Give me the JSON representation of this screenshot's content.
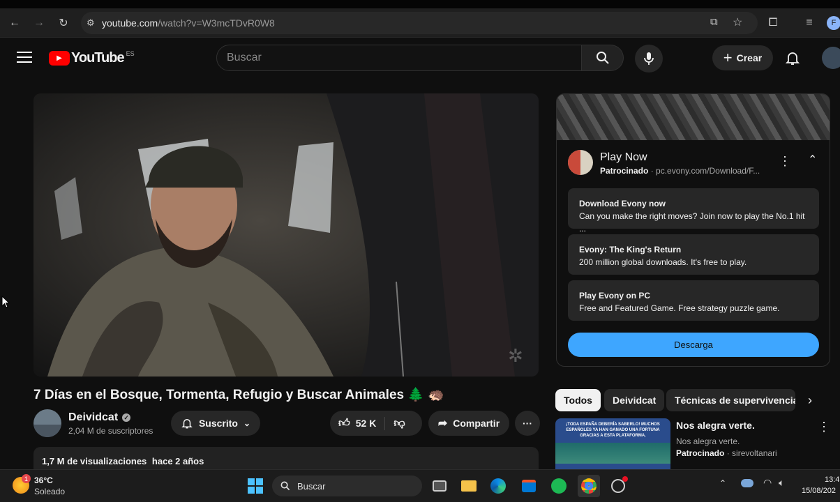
{
  "browser": {
    "url_host": "youtube.com",
    "url_path": "/watch?v=W3mcTDvR0W8",
    "profile_initial": "F"
  },
  "header": {
    "logo_text": "YouTube",
    "region": "ES",
    "search_placeholder": "Buscar",
    "create_label": "Crear"
  },
  "video": {
    "title": "7 Días en el Bosque, Tormenta, Refugio y Buscar Animales 🌲 🦔",
    "channel": "Deividcat",
    "subscribers": "2,04 M de suscriptores",
    "subscribed_label": "Suscrito",
    "likes": "52 K",
    "share_label": "Compartir",
    "views": "1,7 M de visualizaciones",
    "age": "hace 2 años"
  },
  "ad": {
    "title": "Play Now",
    "sponsored": "Patrocinado",
    "domain": "· pc.evony.com/Download/F...",
    "cards": [
      {
        "heading": "Download Evony now",
        "text": "Can you make the right moves? Join now to play the No.1 hit ..."
      },
      {
        "heading": "Evony: The King's Return",
        "text": "200 million global downloads. It's free to play."
      },
      {
        "heading": "Play Evony on PC",
        "text": "Free and Featured Game. Free strategy puzzle game."
      }
    ],
    "cta": "Descarga"
  },
  "chips": [
    "Todos",
    "Deividcat",
    "Técnicas de supervivencia"
  ],
  "rec": {
    "title": "Nos alegra verte.",
    "subtitle": "Nos alegra verte.",
    "sponsored": "Patrocinado",
    "source": "· sirevoltanari",
    "thumb_text": "¡TODA ESPAÑA DEBERÍA SABERLO! MUCHOS ESPAÑOLES YA HAN GANADO UNA FORTUNA GRACIAS A ESTA PLATAFORMA."
  },
  "taskbar": {
    "temp": "36°C",
    "weather": "Soleado",
    "weather_badge": "1",
    "search_label": "Buscar",
    "time": "13:4",
    "date": "15/08/202"
  },
  "colors": {
    "accent": "#3ea6ff",
    "yt_red": "#ff0000",
    "spotify": "#1db954"
  }
}
